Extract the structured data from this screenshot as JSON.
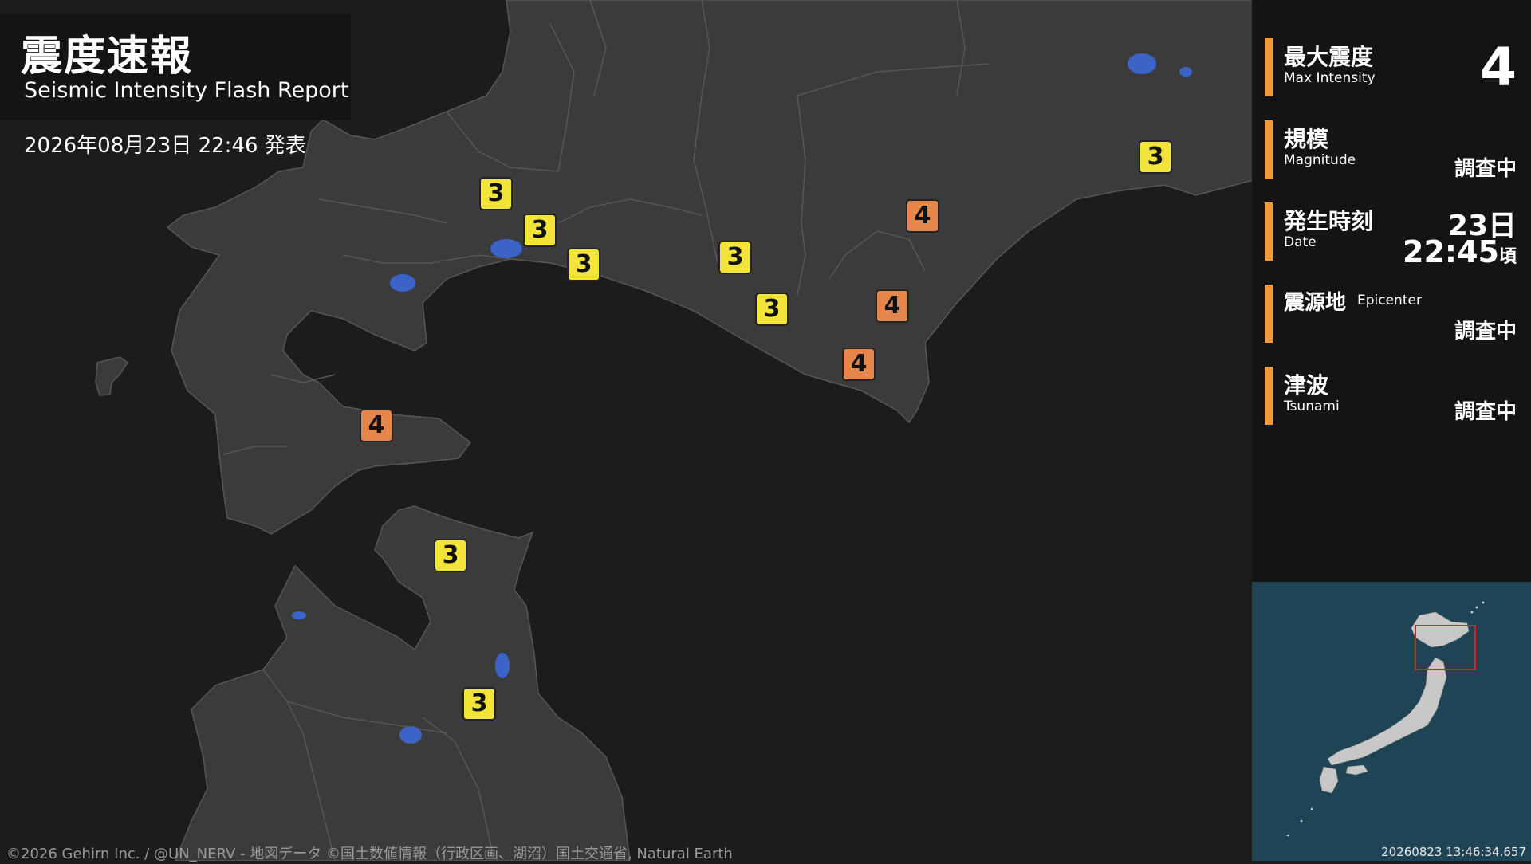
{
  "header": {
    "title_jp": "震度速報",
    "title_en": "Seismic Intensity Flash Report",
    "issued": "2026年08月23日 22:46 発表"
  },
  "panel": {
    "max_intensity": {
      "label_jp": "最大震度",
      "label_en": "Max Intensity",
      "value": "4"
    },
    "magnitude": {
      "label_jp": "規模",
      "label_en": "Magnitude",
      "value": "調査中"
    },
    "date": {
      "label_jp": "発生時刻",
      "label_en": "Date",
      "day": "23日",
      "time": "22:45",
      "suffix": "頃"
    },
    "epicenter": {
      "label_jp": "震源地",
      "label_en": "Epicenter",
      "value": "調査中"
    },
    "tsunami": {
      "label_jp": "津波",
      "label_en": "Tsunami",
      "value": "調査中"
    }
  },
  "markers": [
    "3",
    "3",
    "3",
    "3",
    "3",
    "3",
    "4",
    "4",
    "4",
    "4",
    "3",
    "3"
  ],
  "credit": "©2026 Gehirn Inc. / @UN_NERV - 地図データ ©国土数値情報（行政区画、湖沼）国土交通省, Natural Earth",
  "timestamp": "20260823 13:46:34.657",
  "colors": {
    "intensity_3": "#f3e43a",
    "intensity_4": "#e5874a",
    "accent_bar": "#f39a3c",
    "land": "#3b3b3b",
    "sea": "#1c1c1c",
    "lake": "#3c64c8",
    "inset_sea": "#1f4456"
  }
}
